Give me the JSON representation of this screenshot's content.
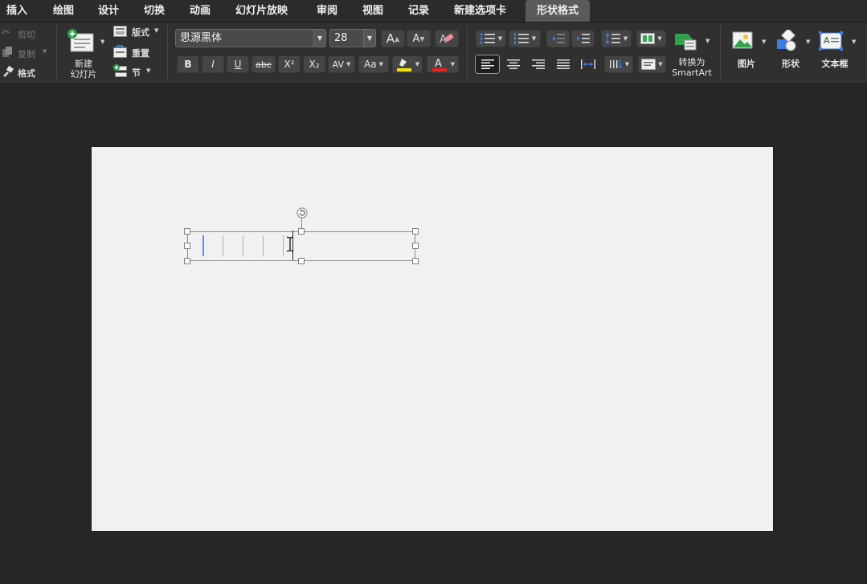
{
  "tabs": [
    {
      "label": "插入"
    },
    {
      "label": "绘图"
    },
    {
      "label": "设计"
    },
    {
      "label": "切换"
    },
    {
      "label": "动画"
    },
    {
      "label": "幻灯片放映"
    },
    {
      "label": "审阅"
    },
    {
      "label": "视图"
    },
    {
      "label": "记录"
    },
    {
      "label": "新建选项卡"
    },
    {
      "label": "形状格式"
    }
  ],
  "clipboard": {
    "cut": "剪切",
    "copy": "复制",
    "format": "格式"
  },
  "slides": {
    "new_slide_line1": "新建",
    "new_slide_line2": "幻灯片",
    "layout": "版式",
    "reset": "重置",
    "section": "节"
  },
  "font": {
    "name": "思源黑体",
    "size": "28",
    "bold": "B",
    "italic": "I",
    "underline": "U",
    "strike": "abc",
    "superscript": "X²",
    "subscript": "X₂",
    "char_spacing": "AV",
    "change_case": "Aa",
    "grow": "A",
    "shrink": "A",
    "highlight_color": "#f5e400",
    "font_color": "#e8201c"
  },
  "paragraph": {
    "smartart_line1": "转换为",
    "smartart_line2": "SmartArt"
  },
  "insert": {
    "picture": "图片",
    "shape": "形状",
    "textbox": "文本框"
  },
  "colors": {
    "background": "#262626",
    "ribbon": "#303030",
    "slide": "#f1f1f1",
    "accent_blue": "#3c7be0"
  }
}
